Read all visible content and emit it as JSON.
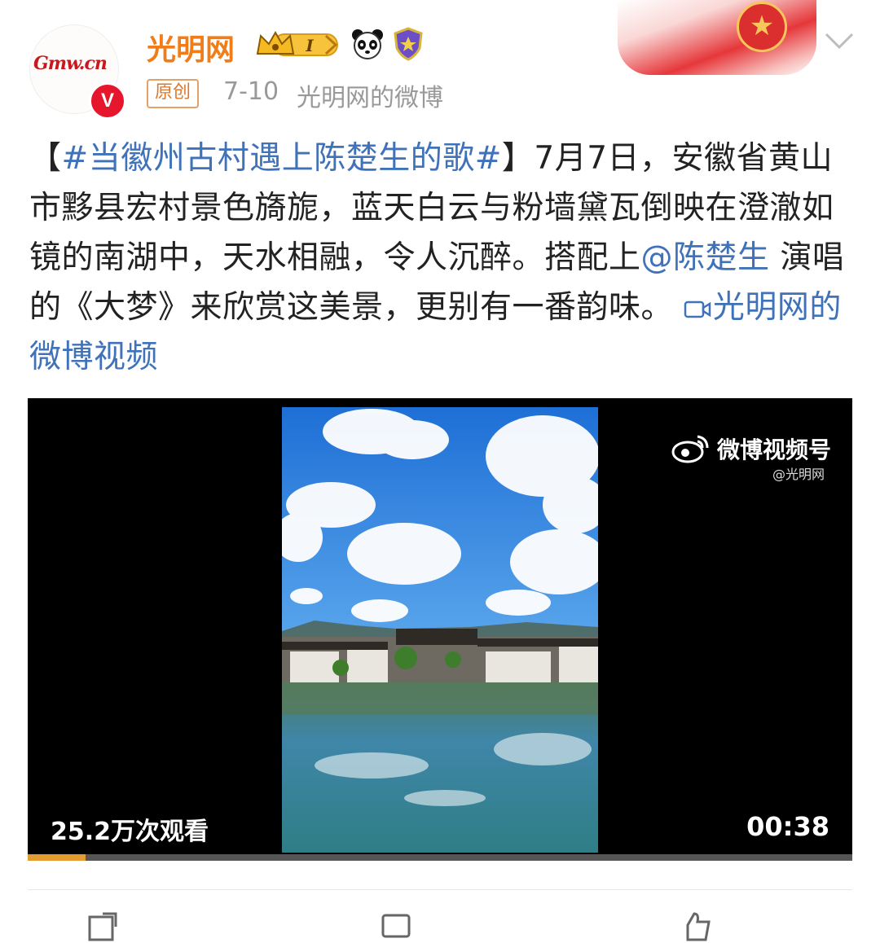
{
  "header": {
    "username": "光明网",
    "avatar_mark": "Gmw.cn",
    "verified_badge": "V",
    "level_badge": "I",
    "original_tag": "原创",
    "date": "7-10",
    "source": "光明网的微博"
  },
  "post": {
    "bracket_open": "【",
    "hashtag": "#当徽州古村遇上陈楚生的歌#",
    "bracket_close": "】",
    "text_1": "7月7日，安徽省黄山市黟县宏村景色旖旎，蓝天白云与粉墙黛瓦倒映在澄澈如镜的南湖中，天水相融，令人沉醉。搭配上",
    "mention": "@陈楚生",
    "text_2": " 演唱的《大梦》来欣赏这美景，更别有一番韵味。 ",
    "video_link": "光明网的微博视频"
  },
  "video": {
    "watermark": "微博视频号",
    "watermark_handle": "@光明网",
    "views": "25.2万次观看",
    "duration": "00:38",
    "progress_fraction": 0.07
  },
  "colors": {
    "username": "#f07d17",
    "link": "#3f72b8",
    "progress": "#e39a2f"
  }
}
